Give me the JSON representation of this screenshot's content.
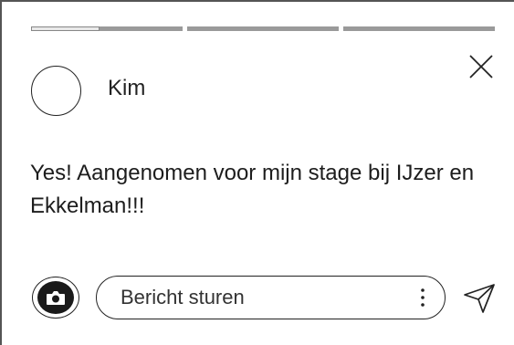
{
  "story": {
    "progress": [
      0.45,
      0,
      0
    ],
    "username": "Kim",
    "message": "Yes! Aangenomen voor mijn stage bij IJzer en Ekkelman!!!"
  },
  "reply": {
    "placeholder": "Bericht sturen"
  },
  "icons": {
    "close": "close-icon",
    "camera": "camera-icon",
    "more": "more-vertical-icon",
    "send": "send-icon"
  },
  "colors": {
    "progress_track": "#9a9a9a",
    "progress_fill": "#e9e9e9",
    "text": "#1d1d1d"
  }
}
